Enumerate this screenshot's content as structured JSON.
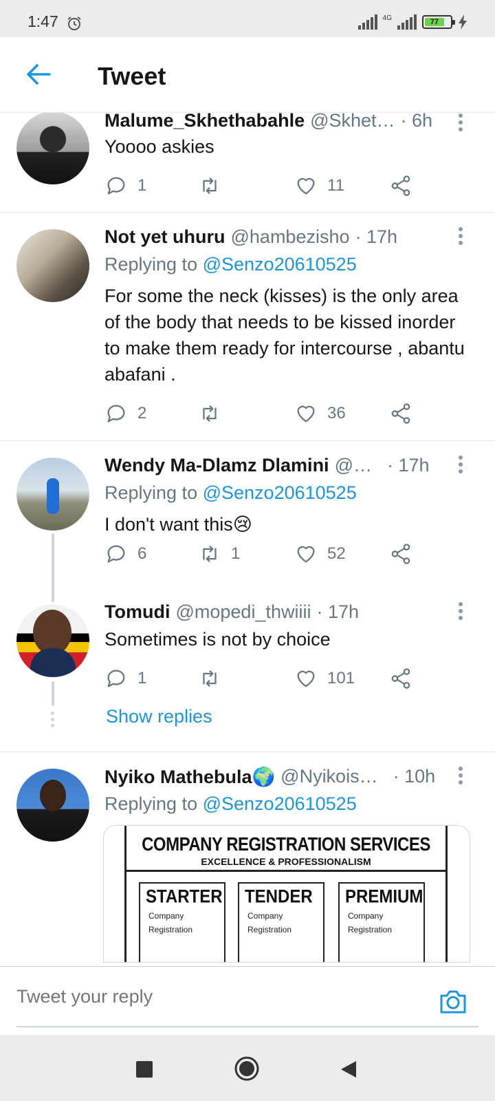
{
  "status_bar": {
    "time": "1:47",
    "network": "4G",
    "battery_level": "77"
  },
  "header": {
    "title": "Tweet"
  },
  "tweets": [
    {
      "name": "Malume_Skhethabahle",
      "handle": "@Skhet…",
      "time": "· 6h",
      "reply_to_label": "",
      "reply_to": "",
      "text": "Yoooo askies",
      "replies": "1",
      "retweets": "",
      "likes": "11"
    },
    {
      "name": "Not yet uhuru",
      "handle": "@hambezisho",
      "time": "· 17h",
      "reply_to_label": "Replying to",
      "reply_to": "@Senzo20610525",
      "text": "For some the neck (kisses) is the only area of the body that needs to be kissed inorder to make them ready for intercourse , abantu abafani .",
      "replies": "2",
      "retweets": "",
      "likes": "36"
    },
    {
      "name": "Wendy Ma-Dlamz Dlamini",
      "handle": "@…",
      "time": "· 17h",
      "reply_to_label": "Replying to",
      "reply_to": "@Senzo20610525",
      "text": "I don't want this😢",
      "replies": "6",
      "retweets": "1",
      "likes": "52"
    },
    {
      "name": "Tomudi",
      "handle": "@mopedi_thwiiii",
      "time": "· 17h",
      "reply_to_label": "",
      "reply_to": "",
      "text": "Sometimes is not by choice",
      "replies": "1",
      "retweets": "",
      "likes": "101"
    },
    {
      "name": "Nyiko Mathebula🌍",
      "handle": "@Nyikois…",
      "time": "· 10h",
      "reply_to_label": "Replying to",
      "reply_to": "@Senzo20610525",
      "text": "",
      "replies": "",
      "retweets": "",
      "likes": ""
    }
  ],
  "show_replies": "Show replies",
  "media": {
    "title": "COMPANY REGISTRATION SERVICES",
    "subtitle": "EXCELLENCE & PROFESSIONALISM",
    "boxes": [
      {
        "title": "STARTER",
        "line1": "Company",
        "line2": "Registration"
      },
      {
        "title": "TENDER",
        "line1": "Company",
        "line2": "Registration"
      },
      {
        "title": "PREMIUM",
        "line1": "Company",
        "line2": "Registration"
      }
    ]
  },
  "reply_bar": {
    "placeholder": "Tweet your reply"
  },
  "colors": {
    "accent": "#1b95e0",
    "muted": "#657786",
    "text": "#14171a",
    "divider": "#e1e8ed"
  },
  "icons": [
    "alarm-icon",
    "signal-icon",
    "battery-icon",
    "charging-icon",
    "back-arrow-icon",
    "reply-icon",
    "retweet-icon",
    "like-icon",
    "share-icon",
    "more-icon",
    "camera-icon",
    "nav-recents-icon",
    "nav-home-icon",
    "nav-back-icon"
  ]
}
